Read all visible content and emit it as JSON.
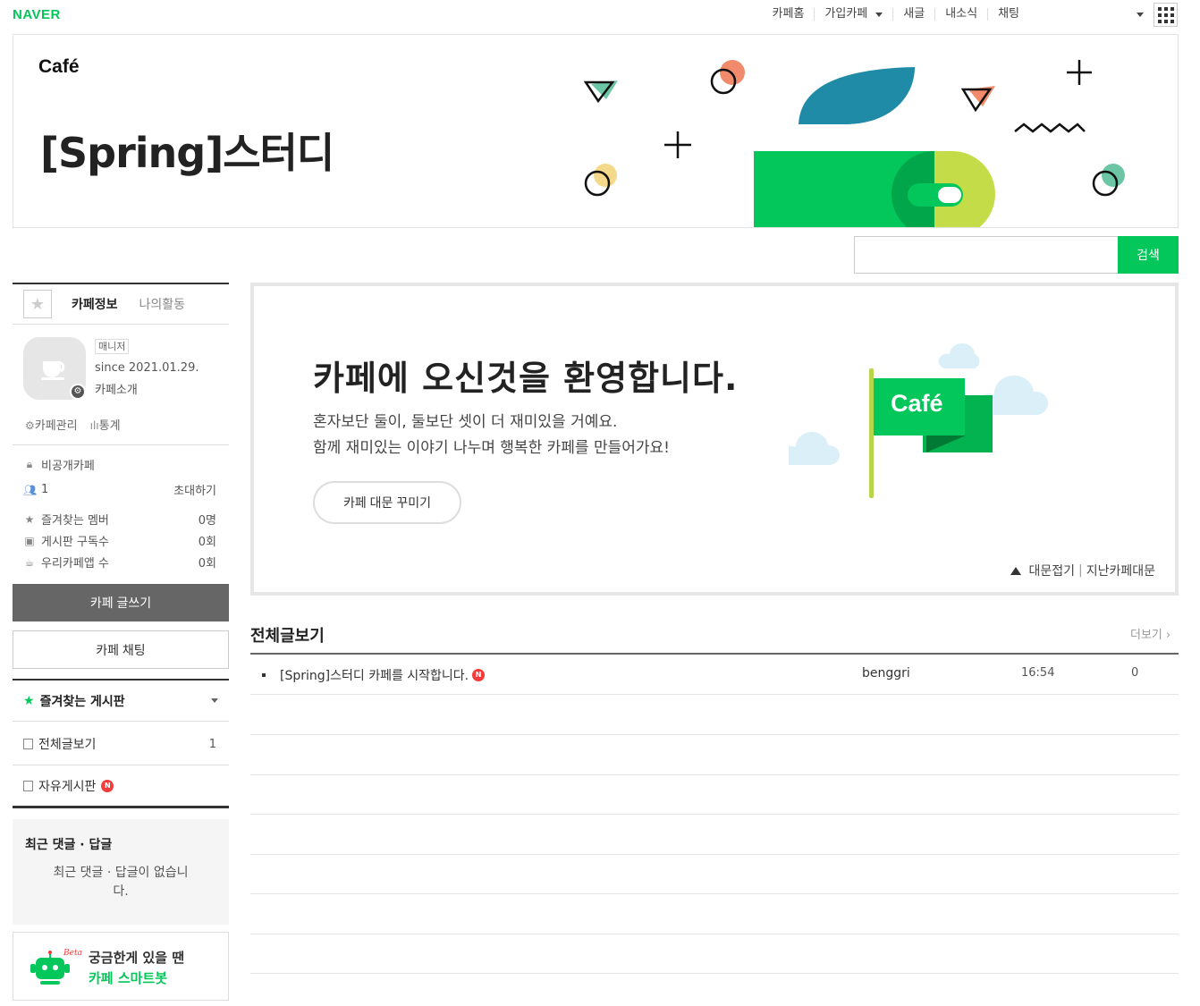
{
  "top": {
    "logo": "NAVER",
    "nav": [
      "카페홈",
      "가입카페",
      "새글",
      "내소식",
      "채팅"
    ]
  },
  "header": {
    "cafe_logo": "Café",
    "cafe_name": "[Spring]스터디"
  },
  "search": {
    "button": "검색",
    "value": ""
  },
  "sidebar": {
    "tabs": [
      "카페정보",
      "나의활동"
    ],
    "profile": {
      "role": "매니저",
      "since": "since 2021.01.29.",
      "intro": "카페소개",
      "manage": "카페관리",
      "stats": "통계"
    },
    "info": {
      "privacy": "비공개카페",
      "members": "1",
      "invite": "초대하기",
      "rows": [
        {
          "label": "즐겨찾는 멤버",
          "value": "0명"
        },
        {
          "label": "게시판 구독수",
          "value": "0회"
        },
        {
          "label": "우리카페앱 수",
          "value": "0회"
        }
      ]
    },
    "write_button": "카페 글쓰기",
    "chat_button": "카페 채팅",
    "fav_boards_title": "즐겨찾는 게시판",
    "boards": [
      {
        "name": "전체글보기",
        "count": "1"
      },
      {
        "name": "자유게시판",
        "badge": "N"
      }
    ],
    "recent": {
      "title": "최근 댓글 · 답글",
      "empty": "최근 댓글 · 답글이 없습니다."
    },
    "bot": {
      "beta": "Beta",
      "line1": "궁금한게 있을 땐",
      "line2": "카페 스마트봇"
    }
  },
  "welcome": {
    "title": "카페에 오신것을 환영합니다.",
    "line1": "혼자보단 둘이, 둘보단 셋이 더 재미있을 거예요.",
    "line2": "함께 재미있는 이야기 나누며 행복한 카페를 만들어가요!",
    "button": "카페 대문 꾸미기",
    "flag": "Café",
    "fold": "대문접기",
    "past": "지난카페대문"
  },
  "list": {
    "title": "전체글보기",
    "more": "더보기",
    "rows": [
      {
        "subject": "[Spring]스터디 카페를 시작합니다.",
        "badge": "N",
        "author": "benggri",
        "time": "16:54",
        "views": "0"
      }
    ]
  },
  "colors": {
    "accent": "#03c75a",
    "new_badge": "#f53c3c",
    "write_button": "#666666"
  }
}
